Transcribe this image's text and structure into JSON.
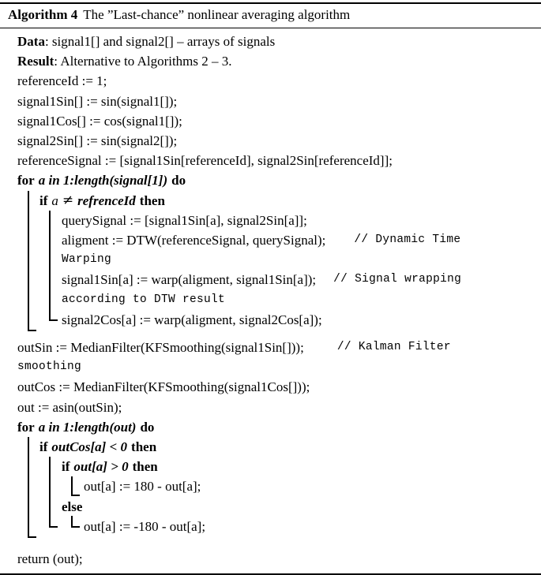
{
  "caption": {
    "label": "Algorithm 4",
    "title": "The ”Last-chance” nonlinear averaging algorithm"
  },
  "lines": {
    "data_kw": "Data",
    "data_text": ": signal1[] and signal2[] – arrays of signals",
    "result_kw": "Result",
    "result_text": ": Alternative to Algorithms 2 – 3.",
    "l_referenceId": "referenceId := 1;",
    "l_signal1Sin": "signal1Sin[] := sin(signal1[]);",
    "l_signal1Cos": "signal1Cos[] := cos(signal1[]);",
    "l_signal2Sin": "signal2Sin[] := sin(signal2[]);",
    "l_referenceSignal": "referenceSignal := [signal1Sin[referenceId], signal2Sin[referenceId]];",
    "for1_kw": "for",
    "for1_cond": "a in 1:length(signal[1])",
    "for1_do": "do",
    "if1_kw": "if",
    "if1_cond_a": "a",
    "if1_neq": "≠",
    "if1_cond_b": "refrenceId",
    "if1_then": "then",
    "l_querySignal": "querySignal := [signal1Sin[a], signal2Sin[a]];",
    "l_aligment": "aligment := DTW(referenceSignal, querySignal);",
    "c_dtw": "// Dynamic Time",
    "c_dtw_cont": "Warping",
    "l_warp1": "signal1Sin[a] := warp(aligment, signal1Sin[a]);",
    "c_warp": "// Signal wrapping",
    "c_warp_cont": "according to DTW result",
    "l_warp2": "signal2Cos[a] := warp(aligment, signal2Cos[a]);",
    "l_outSin": "outSin := MedianFilter(KFSmoothing(signal1Sin[]));",
    "c_kalman": "// Kalman Filter",
    "c_kalman_cont": "smoothing",
    "l_outCos": "outCos := MedianFilter(KFSmoothing(signal1Cos[]));",
    "l_out_asin": "out := asin(outSin);",
    "for2_kw": "for",
    "for2_cond": "a in 1:length(out)",
    "for2_do": "do",
    "if2_kw": "if",
    "if2_cond": "outCos[a] < 0",
    "if2_then": "then",
    "if3_kw": "if",
    "if3_cond": "out[a] > 0",
    "if3_then": "then",
    "l_assign_pos": "out[a] := 180 - out[a];",
    "else_kw": "else",
    "l_assign_neg": "out[a] := -180 - out[a];",
    "l_return": "return (out);"
  }
}
